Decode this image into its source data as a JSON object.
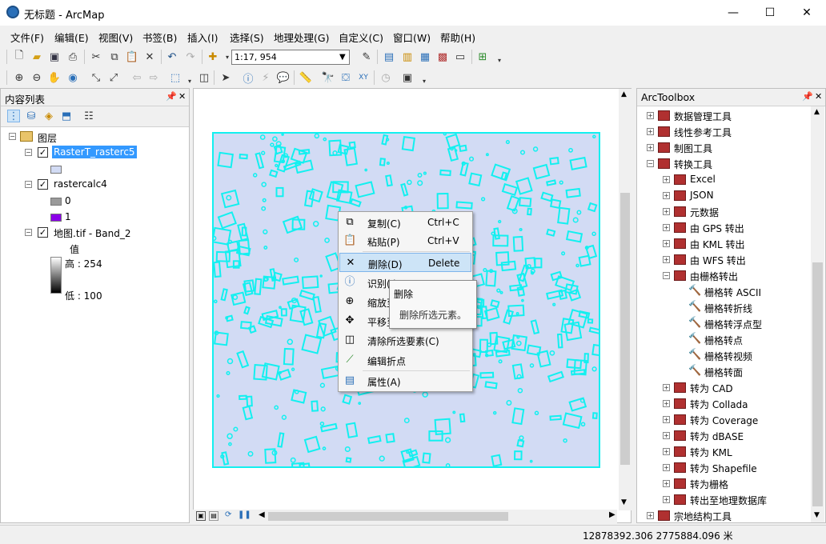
{
  "window": {
    "title": "无标题 - ArcMap",
    "min": "—",
    "max": "☐",
    "close": "✕"
  },
  "menubar": [
    "文件(F)",
    "编辑(E)",
    "视图(V)",
    "书签(B)",
    "插入(I)",
    "选择(S)",
    "地理处理(G)",
    "自定义(C)",
    "窗口(W)",
    "帮助(H)"
  ],
  "toolbar": {
    "scale": "1:17, 954"
  },
  "toc": {
    "title": "内容列表",
    "root": "图层",
    "layers": [
      {
        "name": "RasterT_rasterc5",
        "checked": true,
        "selected": true
      },
      {
        "name": "rastercalc4",
        "checked": true,
        "legend": [
          {
            "label": "0",
            "color": "#9a9a9a"
          },
          {
            "label": "1",
            "color": "#8b00e8"
          }
        ]
      },
      {
        "name": "地图.tif - Band_2",
        "checked": true,
        "value_label": "值",
        "high": "高 : 254",
        "low": "低 : 100"
      }
    ]
  },
  "context_menu": [
    {
      "label": "复制(C)",
      "shortcut": "Ctrl+C",
      "icon": "copy-icon"
    },
    {
      "label": "粘贴(P)",
      "shortcut": "Ctrl+V",
      "icon": "paste-icon"
    },
    {
      "label": "删除(D)",
      "shortcut": "Delete",
      "icon": "delete-icon",
      "highlighted": true
    },
    {
      "label": "识别(I)",
      "shortcut": "",
      "icon": "identify-icon"
    },
    {
      "label": "缩放至",
      "shortcut": "",
      "icon": "zoom-to-icon"
    },
    {
      "label": "平移至",
      "shortcut": "",
      "icon": "pan-to-icon"
    },
    {
      "label": "清除所选要素(C)",
      "shortcut": "",
      "icon": "clear-selection-icon"
    },
    {
      "label": "编辑折点",
      "shortcut": "",
      "icon": "edit-vertices-icon"
    },
    {
      "label": "属性(A)",
      "shortcut": "",
      "icon": "properties-icon"
    }
  ],
  "tooltip": {
    "title": "删除",
    "body": "删除所选元素。"
  },
  "toolbox": {
    "title": "ArcToolbox",
    "items": [
      {
        "label": "数据管理工具",
        "level": 0,
        "type": "box",
        "state": "+"
      },
      {
        "label": "线性参考工具",
        "level": 0,
        "type": "box",
        "state": "+"
      },
      {
        "label": "制图工具",
        "level": 0,
        "type": "box",
        "state": "+"
      },
      {
        "label": "转换工具",
        "level": 0,
        "type": "box",
        "state": "-"
      },
      {
        "label": "Excel",
        "level": 1,
        "type": "set",
        "state": "+"
      },
      {
        "label": "JSON",
        "level": 1,
        "type": "set",
        "state": "+"
      },
      {
        "label": "元数据",
        "level": 1,
        "type": "set",
        "state": "+"
      },
      {
        "label": "由 GPS 转出",
        "level": 1,
        "type": "set",
        "state": "+"
      },
      {
        "label": "由 KML 转出",
        "level": 1,
        "type": "set",
        "state": "+"
      },
      {
        "label": "由 WFS 转出",
        "level": 1,
        "type": "set",
        "state": "+"
      },
      {
        "label": "由栅格转出",
        "level": 1,
        "type": "set",
        "state": "-"
      },
      {
        "label": "栅格转 ASCII",
        "level": 2,
        "type": "tool",
        "state": ""
      },
      {
        "label": "栅格转折线",
        "level": 2,
        "type": "tool",
        "state": ""
      },
      {
        "label": "栅格转浮点型",
        "level": 2,
        "type": "tool",
        "state": ""
      },
      {
        "label": "栅格转点",
        "level": 2,
        "type": "tool",
        "state": ""
      },
      {
        "label": "栅格转视频",
        "level": 2,
        "type": "tool",
        "state": ""
      },
      {
        "label": "栅格转面",
        "level": 2,
        "type": "tool",
        "state": ""
      },
      {
        "label": "转为 CAD",
        "level": 1,
        "type": "set",
        "state": "+"
      },
      {
        "label": "转为 Collada",
        "level": 1,
        "type": "set",
        "state": "+"
      },
      {
        "label": "转为 Coverage",
        "level": 1,
        "type": "set",
        "state": "+"
      },
      {
        "label": "转为 dBASE",
        "level": 1,
        "type": "set",
        "state": "+"
      },
      {
        "label": "转为 KML",
        "level": 1,
        "type": "set",
        "state": "+"
      },
      {
        "label": "转为 Shapefile",
        "level": 1,
        "type": "set",
        "state": "+"
      },
      {
        "label": "转为栅格",
        "level": 1,
        "type": "set",
        "state": "+"
      },
      {
        "label": "转出至地理数据库",
        "level": 1,
        "type": "set",
        "state": "+"
      },
      {
        "label": "宗地结构工具",
        "level": 0,
        "type": "box",
        "state": "+"
      }
    ]
  },
  "status": {
    "coords": "12878392.306  2775884.096 米"
  },
  "colors": {
    "map_fill": "#d2dbf4",
    "polygon_stroke": "#12f0f0",
    "selection": "#3399ff"
  }
}
